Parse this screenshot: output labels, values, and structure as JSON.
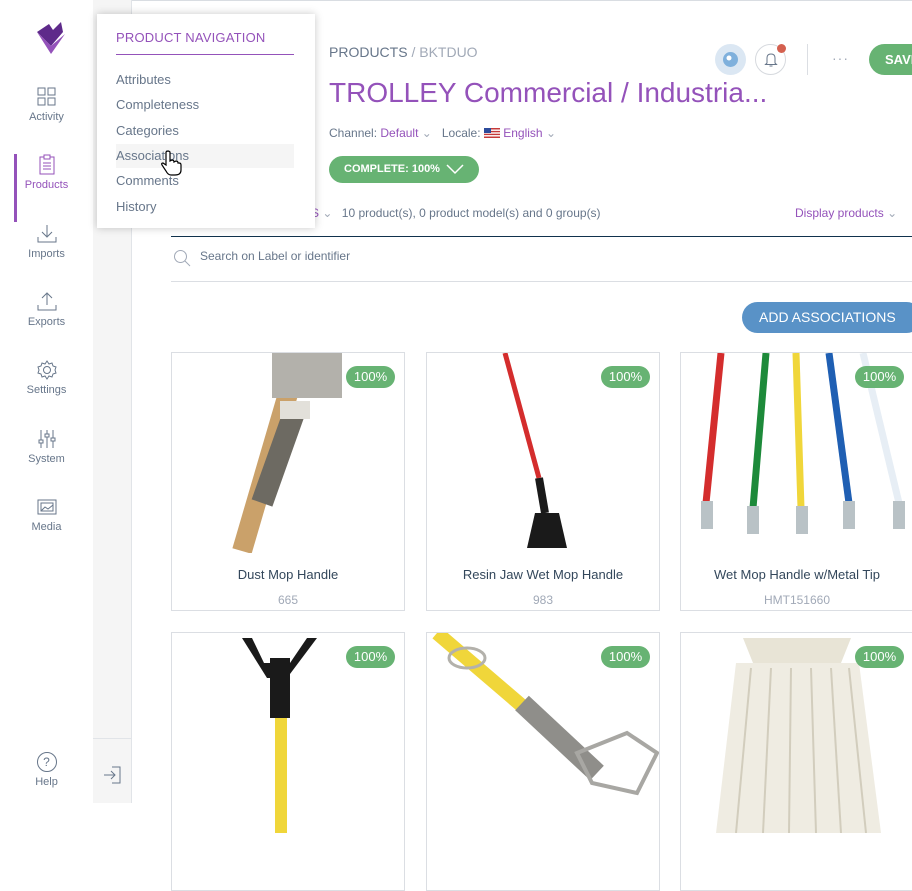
{
  "nav": {
    "items": [
      {
        "label": "Activity",
        "icon": "activity-icon"
      },
      {
        "label": "Products",
        "icon": "products-icon"
      },
      {
        "label": "Imports",
        "icon": "imports-icon"
      },
      {
        "label": "Exports",
        "icon": "exports-icon"
      },
      {
        "label": "Settings",
        "icon": "settings-icon"
      },
      {
        "label": "System",
        "icon": "system-icon"
      },
      {
        "label": "Media",
        "icon": "media-icon"
      }
    ],
    "active": "Products",
    "help": "Help",
    "accent": "#9452ba"
  },
  "dropdown": {
    "title": "PRODUCT NAVIGATION",
    "items": [
      "Attributes",
      "Completeness",
      "Categories",
      "Associations",
      "Comments",
      "History"
    ],
    "hovered": "Associations"
  },
  "header": {
    "breadcrumb_root": "PRODUCTS",
    "breadcrumb_sep": " / ",
    "breadcrumb_leaf": "BKTDUO",
    "title": "TROLLEY Commercial / Industria...",
    "channel_label": "Channel:",
    "channel_value": "Default",
    "locale_label": "Locale:",
    "locale_value": "English",
    "complete_label": "COMPLETE: 100%",
    "save_label": "SAVE",
    "more": "···"
  },
  "toolbar": {
    "type_fragment": "S",
    "summary": "10 product(s), 0 product model(s) and 0 group(s)",
    "display": "Display products"
  },
  "search": {
    "placeholder": "Search on Label or identifier"
  },
  "add_associations": "ADD ASSOCIATIONS",
  "products": [
    {
      "name": "Dust Mop Handle",
      "code": "665",
      "completeness": "100%"
    },
    {
      "name": "Resin Jaw Wet Mop Handle",
      "code": "983",
      "completeness": "100%"
    },
    {
      "name": "Wet Mop Handle w/Metal Tip",
      "code": "HMT151660",
      "completeness": "100%"
    },
    {
      "name": "",
      "code": "",
      "completeness": "100%"
    },
    {
      "name": "",
      "code": "",
      "completeness": "100%"
    },
    {
      "name": "",
      "code": "",
      "completeness": "100%"
    }
  ],
  "colors": {
    "success": "#67b373",
    "primary": "#5992c7",
    "purple": "#9452ba"
  }
}
